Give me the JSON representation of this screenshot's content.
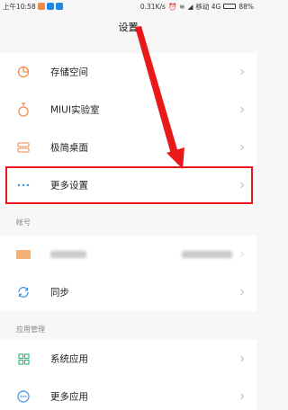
{
  "status": {
    "time": "上午10:58",
    "net_speed": "0.31K/s",
    "carrier": "移动 4G",
    "battery": "88%",
    "battery_level": 0.88
  },
  "header": {
    "title": "设置"
  },
  "main_items": [
    {
      "label": "存储空间",
      "icon": "storage-icon"
    },
    {
      "label": "MIUI实验室",
      "icon": "lab-flask-icon"
    },
    {
      "label": "极简桌面",
      "icon": "simple-desktop-icon"
    },
    {
      "label": "更多设置",
      "icon": "more-dots-icon"
    }
  ],
  "account_section": {
    "title": "帐号",
    "items": [
      {
        "label": "",
        "icon": "account-avatar-icon"
      },
      {
        "label": "同步",
        "icon": "sync-icon"
      }
    ]
  },
  "apps_section": {
    "title": "应用管理",
    "items": [
      {
        "label": "系统应用",
        "icon": "system-apps-icon"
      },
      {
        "label": "更多应用",
        "icon": "more-apps-icon"
      }
    ]
  },
  "colors": {
    "accent_orange": "#f08a4b",
    "annotation_red": "#e8191b",
    "chevron": "#bbbbbb"
  }
}
